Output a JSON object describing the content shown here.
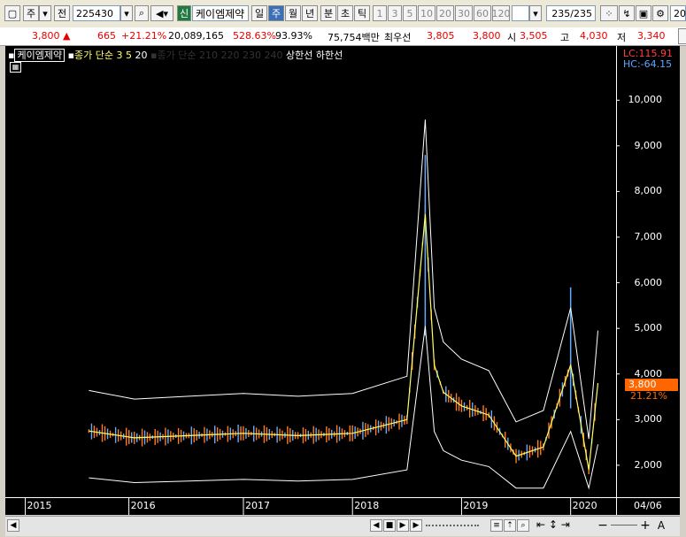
{
  "toolbar": {
    "market": "주",
    "prev": "전",
    "code": "225430",
    "badge": "신",
    "name": "케이엠제약",
    "periods": [
      "일",
      "주",
      "월",
      "년",
      "분",
      "초",
      "틱"
    ],
    "selected_period": "주",
    "intervals": [
      "1",
      "3",
      "5",
      "10",
      "20",
      "30",
      "60",
      "120"
    ],
    "page": "235/235",
    "trailing": "20"
  },
  "quote": {
    "price": "3,800",
    "arrow": "▲",
    "change": "665",
    "change_rate": "+21.21%",
    "volume": "20,089,165",
    "volume_ratio": "528.63%",
    "strength": "93.93%",
    "amount": "75,754백만",
    "best_bid_label": "최우선",
    "best_bid": "3,805",
    "best_ask": "3,800",
    "open_label": "시",
    "open": "3,505",
    "high_label": "고",
    "high": "4,030",
    "low_label": "저",
    "low": "3,340"
  },
  "legend": {
    "stock": "케이엠제약",
    "ma_label": "종가 단순",
    "ma_values": [
      "3",
      "5",
      "20"
    ],
    "ma_hidden": "종가 단순 210  220  230  240",
    "upper": "상한선",
    "lower": "하한선"
  },
  "chart_info": {
    "lc": "LC:115.91",
    "hc": "HC:-64.15",
    "current_price": "3,800",
    "current_rate": "21.21%"
  },
  "colors": {
    "price_tag": "#ff6600",
    "up_candle": "#ff7b1c",
    "down_candle": "#66aaff",
    "ma3": "#ffff66",
    "ma5": "#ffffff",
    "band": "#ffffff",
    "lc_text": "#ff4040",
    "hc_text": "#5fa8ff"
  },
  "chart_data": {
    "type": "line",
    "y_ticks": [
      "2,000",
      "3,000",
      "4,000",
      "5,000",
      "6,000",
      "7,000",
      "8,000",
      "9,000",
      "10,000"
    ],
    "ylim": [
      1300,
      10800
    ],
    "x_ticks": [
      "2015",
      "2016",
      "2017",
      "2018",
      "2019",
      "2020",
      "04/06"
    ],
    "x": [
      "2015-08",
      "2016-01",
      "2016-07",
      "2017-01",
      "2017-07",
      "2018-01",
      "2018-07",
      "2018-09",
      "2018-10",
      "2018-11",
      "2019-01",
      "2019-04",
      "2019-07",
      "2019-10",
      "2020-01",
      "2020-03",
      "2020-04"
    ],
    "series": [
      {
        "name": "종가",
        "values": [
          2750,
          2600,
          2650,
          2700,
          2650,
          2700,
          3000,
          7500,
          4200,
          3600,
          3300,
          3100,
          2200,
          2400,
          4200,
          1900,
          3800
        ]
      }
    ]
  }
}
